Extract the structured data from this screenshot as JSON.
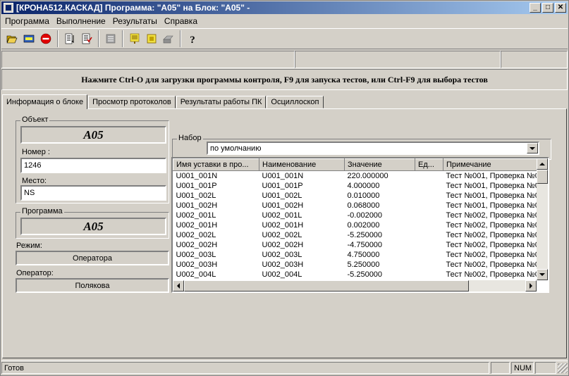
{
  "window": {
    "title": "[КРОНА512.КАСКАД] Программа: \"A05\" на Блок: \"A05\" -"
  },
  "menu": [
    "Программа",
    "Выполнение",
    "Результаты",
    "Справка"
  ],
  "hint": "Нажмите Ctrl-O для загрузки программы контроля, F9 для запуска тестов, или Ctrl-F9 для выбора тестов",
  "tabs": [
    "Информация о блоке",
    "Просмотр протоколов",
    "Результаты работы ПК",
    "Осциллоскоп"
  ],
  "object": {
    "group_label": "Объект",
    "name": "A05",
    "number_label": "Номер :",
    "number": "1246",
    "place_label": "Место:",
    "place": "NS"
  },
  "program": {
    "group_label": "Программа",
    "name": "A05",
    "mode_label": "Режим:",
    "mode": "Оператора",
    "operator_label": "Оператор:",
    "operator": "Полякова"
  },
  "set": {
    "label": "Набор",
    "value": "по умолчанию"
  },
  "grid": {
    "columns": [
      "Имя уставки в про...",
      "Наименование",
      "Значение",
      "Ед...",
      "Примечание"
    ],
    "rows": [
      [
        "U001_001N",
        "U001_001N",
        "220.000000",
        "",
        "Тест №001, Проверка №0"
      ],
      [
        "U001_001P",
        "U001_001P",
        "4.000000",
        "",
        "Тест №001, Проверка №0"
      ],
      [
        "U001_002L",
        "U001_002L",
        "0.010000",
        "",
        "Тест №001, Проверка №0"
      ],
      [
        "U001_002H",
        "U001_002H",
        "0.068000",
        "",
        "Тест №001, Проверка №0"
      ],
      [
        "U002_001L",
        "U002_001L",
        "-0.002000",
        "",
        "Тест №002, Проверка №0"
      ],
      [
        "U002_001H",
        "U002_001H",
        "0.002000",
        "",
        "Тест №002, Проверка №0"
      ],
      [
        "U002_002L",
        "U002_002L",
        "-5.250000",
        "",
        "Тест №002, Проверка №0"
      ],
      [
        "U002_002H",
        "U002_002H",
        "-4.750000",
        "",
        "Тест №002, Проверка №0"
      ],
      [
        "U002_003L",
        "U002_003L",
        "4.750000",
        "",
        "Тест №002, Проверка №0"
      ],
      [
        "U002_003H",
        "U002_003H",
        "5.250000",
        "",
        "Тест №002, Проверка №0"
      ],
      [
        "U002_004L",
        "U002_004L",
        "-5.250000",
        "",
        "Тест №002, Проверка №0"
      ]
    ]
  },
  "status": {
    "text": "Готов",
    "num": "NUM"
  },
  "window_buttons": {
    "minimize": "_",
    "maximize": "□",
    "close": "✕"
  },
  "icons": [
    "open-folder-icon",
    "db-icon",
    "stop-icon",
    "list-icon",
    "checklist-icon",
    "print-preview-icon",
    "note-icon",
    "yellow-box-icon",
    "print-icon",
    "help-icon"
  ]
}
